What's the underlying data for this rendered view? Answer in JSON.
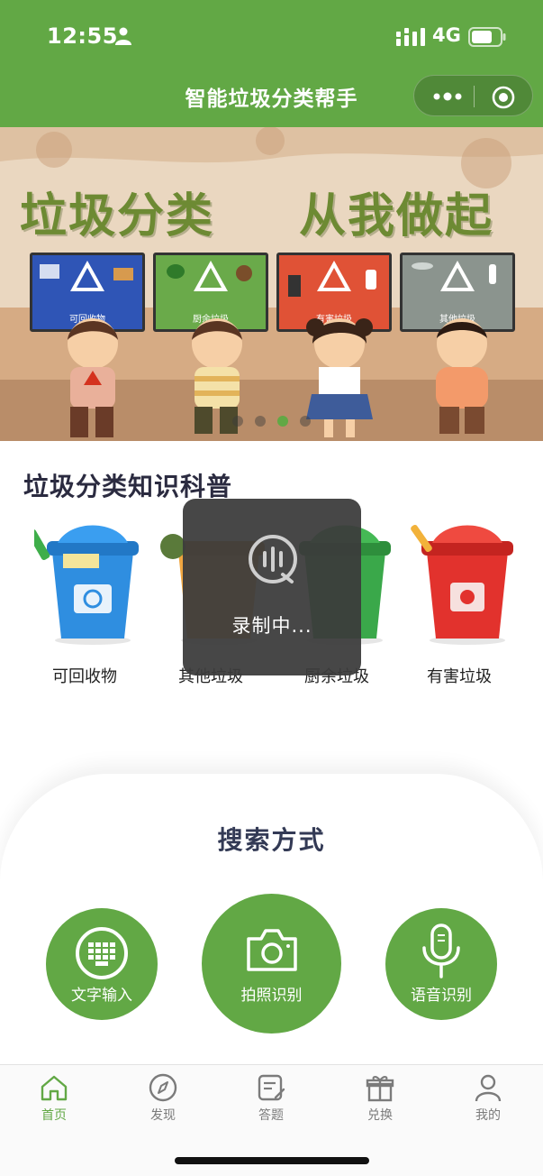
{
  "status_bar": {
    "time": "12:55",
    "network": "4G"
  },
  "header": {
    "title": "智能垃圾分类帮手"
  },
  "banner": {
    "headline_left": "垃圾分类",
    "headline_right": "从我做起",
    "signs": [
      "可回收物",
      "厨余垃圾",
      "有害垃圾",
      "其他垃圾"
    ],
    "carousel_count": 4,
    "carousel_active_index": 2
  },
  "knowledge": {
    "title": "垃圾分类知识科普",
    "bins": [
      {
        "label": "可回收物",
        "color": "#2f8ee0"
      },
      {
        "label": "其他垃圾",
        "color": "#f0a640"
      },
      {
        "label": "厨余垃圾",
        "color": "#3aa84a"
      },
      {
        "label": "有害垃圾",
        "color": "#e2322d"
      }
    ]
  },
  "toast": {
    "text": "录制中..."
  },
  "search": {
    "title": "搜索方式",
    "options": [
      {
        "label": "文字输入",
        "icon": "keyboard-icon"
      },
      {
        "label": "拍照识别",
        "icon": "camera-icon"
      },
      {
        "label": "语音识别",
        "icon": "microphone-icon"
      }
    ]
  },
  "tabbar": {
    "items": [
      {
        "label": "首页",
        "icon": "home-icon",
        "active": true
      },
      {
        "label": "发现",
        "icon": "compass-icon",
        "active": false
      },
      {
        "label": "答题",
        "icon": "quiz-icon",
        "active": false
      },
      {
        "label": "兑换",
        "icon": "gift-icon",
        "active": false
      },
      {
        "label": "我的",
        "icon": "user-icon",
        "active": false
      }
    ]
  },
  "colors": {
    "brand": "#62a845",
    "text_dark": "#2b2b40"
  }
}
